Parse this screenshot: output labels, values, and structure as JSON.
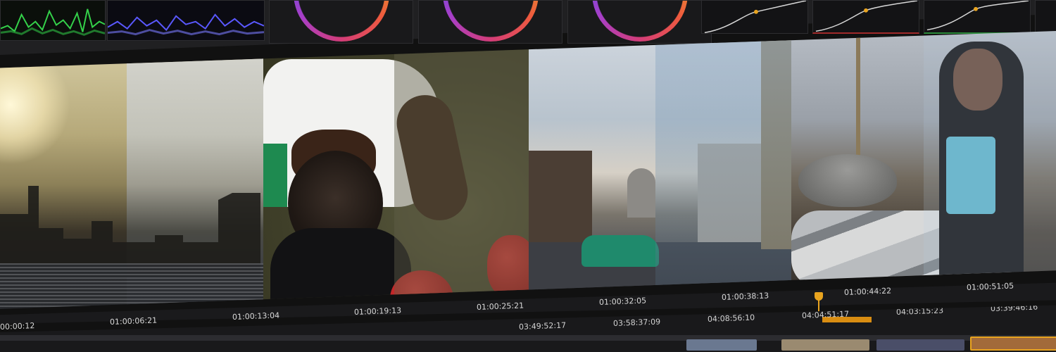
{
  "timeline": {
    "ruler_timecodes": [
      "00:00:12",
      "01:00:06:21",
      "01:00:13:04",
      "01:00:19:13",
      "01:00:25:21",
      "01:00:32:05",
      "01:00:38:13",
      "01:00:44:22",
      "01:00:51:05"
    ]
  },
  "thumbnails": {
    "timecodes": [
      "03:49:52:17",
      "03:58:37:09",
      "04:08:56:10",
      "04:04:51:17",
      "04:03:15:23",
      "03:39:46:16"
    ]
  },
  "colors": {
    "playhead": "#e9a41f",
    "track_highlight": "#d98d12",
    "scope_green": "#34d24a",
    "scope_blue": "#5a58ff",
    "curve_dot": "#e9a41f"
  },
  "icons": {
    "waveform_scope": "waveform-scope-icon",
    "parade_scope": "parade-scope-icon",
    "color_wheel": "color-wheel-icon",
    "curve": "curve-icon",
    "playhead": "playhead-icon"
  }
}
